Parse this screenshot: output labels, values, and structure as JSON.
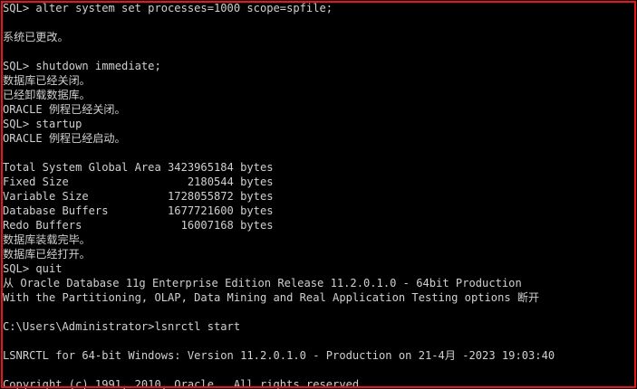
{
  "console": {
    "lines": [
      "SQL> alter system set processes=1000 scope=spfile;",
      "",
      "系统已更改。",
      "",
      "SQL> shutdown immediate;",
      "数据库已经关闭。",
      "已经卸载数据库。",
      "ORACLE 例程已经关闭。",
      "SQL> startup",
      "ORACLE 例程已经启动。",
      "",
      "Total System Global Area 3423965184 bytes",
      "Fixed Size                  2180544 bytes",
      "Variable Size            1728055872 bytes",
      "Database Buffers         1677721600 bytes",
      "Redo Buffers               16007168 bytes",
      "数据库装载完毕。",
      "数据库已经打开。",
      "SQL> quit",
      "从 Oracle Database 11g Enterprise Edition Release 11.2.0.1.0 - 64bit Production",
      "With the Partitioning, OLAP, Data Mining and Real Application Testing options 断开",
      "",
      "C:\\Users\\Administrator>lsnrctl start",
      "",
      "LSNRCTL for 64-bit Windows: Version 11.2.0.1.0 - Production on 21-4月 -2023 19:03:40",
      "",
      "Copyright (c) 1991, 2010, Oracle.  All rights reserved."
    ]
  },
  "colors": {
    "background": "#000000",
    "text": "#d0d0d0",
    "highlight_border": "#e5171b"
  }
}
